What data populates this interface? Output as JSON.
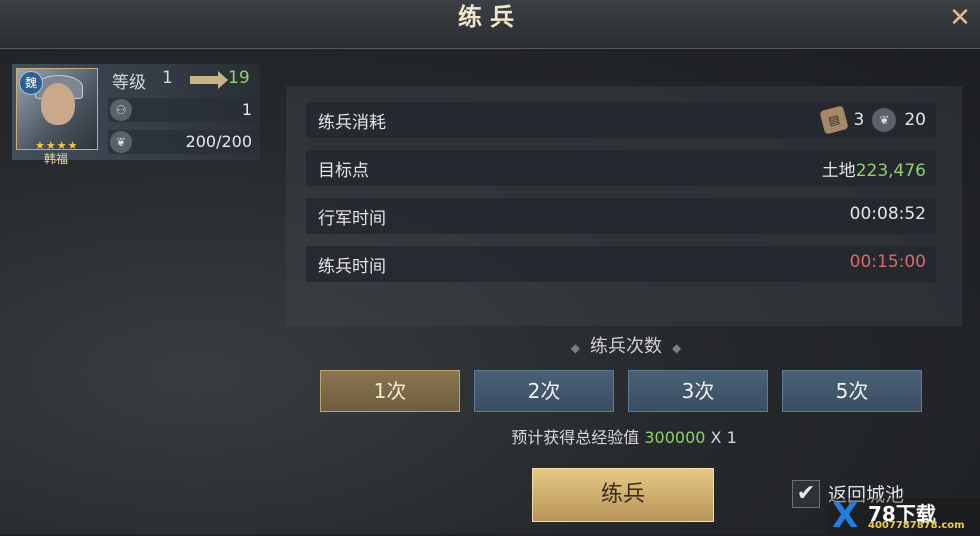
{
  "header": {
    "title": "练兵",
    "close_icon": "close-x-icon"
  },
  "hero": {
    "faction": "魏",
    "name": "韩福",
    "stars": "★★★★",
    "level_label": "等级",
    "level_from": "1",
    "level_to": "19",
    "stat1_icon": "soldier-icon",
    "stat1_value": "1",
    "stat2_icon": "stamina-icon",
    "stat2_value": "200/200"
  },
  "info": {
    "cost_label": "练兵消耗",
    "cost_ticket_value": "3",
    "cost_stamina_value": "20",
    "target_label": "目标点",
    "target_prefix": "土地",
    "target_value": "223,476",
    "march_label": "行军时间",
    "march_value": "00:08:52",
    "train_time_label": "练兵时间",
    "train_time_value": "00:15:00"
  },
  "count": {
    "title": "练兵次数",
    "options": [
      "1次",
      "2次",
      "3次",
      "5次"
    ],
    "selected_index": 0
  },
  "exp": {
    "prefix": "预计获得总经验值",
    "value": "300000",
    "suffix": "X 1"
  },
  "actions": {
    "train_button": "练兵",
    "return_label": "返回城池",
    "return_checked": true
  },
  "watermark": {
    "brand": "78下载",
    "phone": "4007787878.com"
  },
  "colors": {
    "accent_gold": "#c1a36c",
    "positive_green": "#8fd16b",
    "warning_red": "#d96a6a"
  }
}
